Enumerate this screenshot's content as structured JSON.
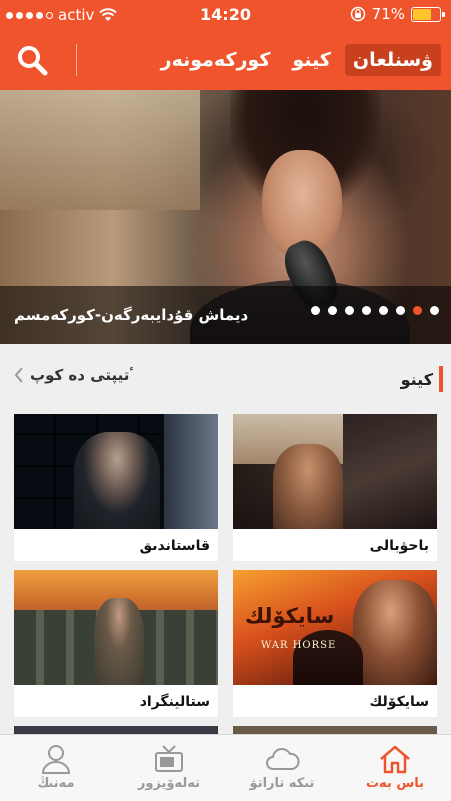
{
  "status": {
    "carrier": "activ",
    "time": "14:20",
    "battery": "71%",
    "battery_level": 0.71,
    "signal_bars": 4
  },
  "nav": {
    "tabs": [
      {
        "label": "ۋسنلعان",
        "active": true
      },
      {
        "label": "كينو",
        "active": false
      },
      {
        "label": "كوركەمونەر",
        "active": false
      }
    ]
  },
  "banner": {
    "caption": "ديماش قۇدايبەرگەن-كوركەمسم",
    "page_count": 8,
    "active_page": 1
  },
  "section": {
    "title": "كينو",
    "more_label": "ٴتيپتى دە كوپ"
  },
  "movies": [
    {
      "title": "باحۋبالى"
    },
    {
      "title": "قاستاندىق"
    },
    {
      "title": "سايكۆلك"
    },
    {
      "title": "ستالينگراد"
    }
  ],
  "poster_texts": {
    "saikolk_title": "سايكۆلك",
    "war_horse": "WAR HORSE"
  },
  "tabbar": {
    "items": [
      {
        "label": "باس بەت",
        "icon": "home-icon",
        "active": true
      },
      {
        "label": "تىكە تاراتۋ",
        "icon": "cloud-icon",
        "active": false
      },
      {
        "label": "تەلەۆيزور",
        "icon": "tv-icon",
        "active": false
      },
      {
        "label": "مەنىڭ",
        "icon": "user-icon",
        "active": false
      }
    ]
  },
  "colors": {
    "accent": "#f0542c",
    "tab_active_bg": "#c9401f",
    "inactive": "#999999"
  }
}
